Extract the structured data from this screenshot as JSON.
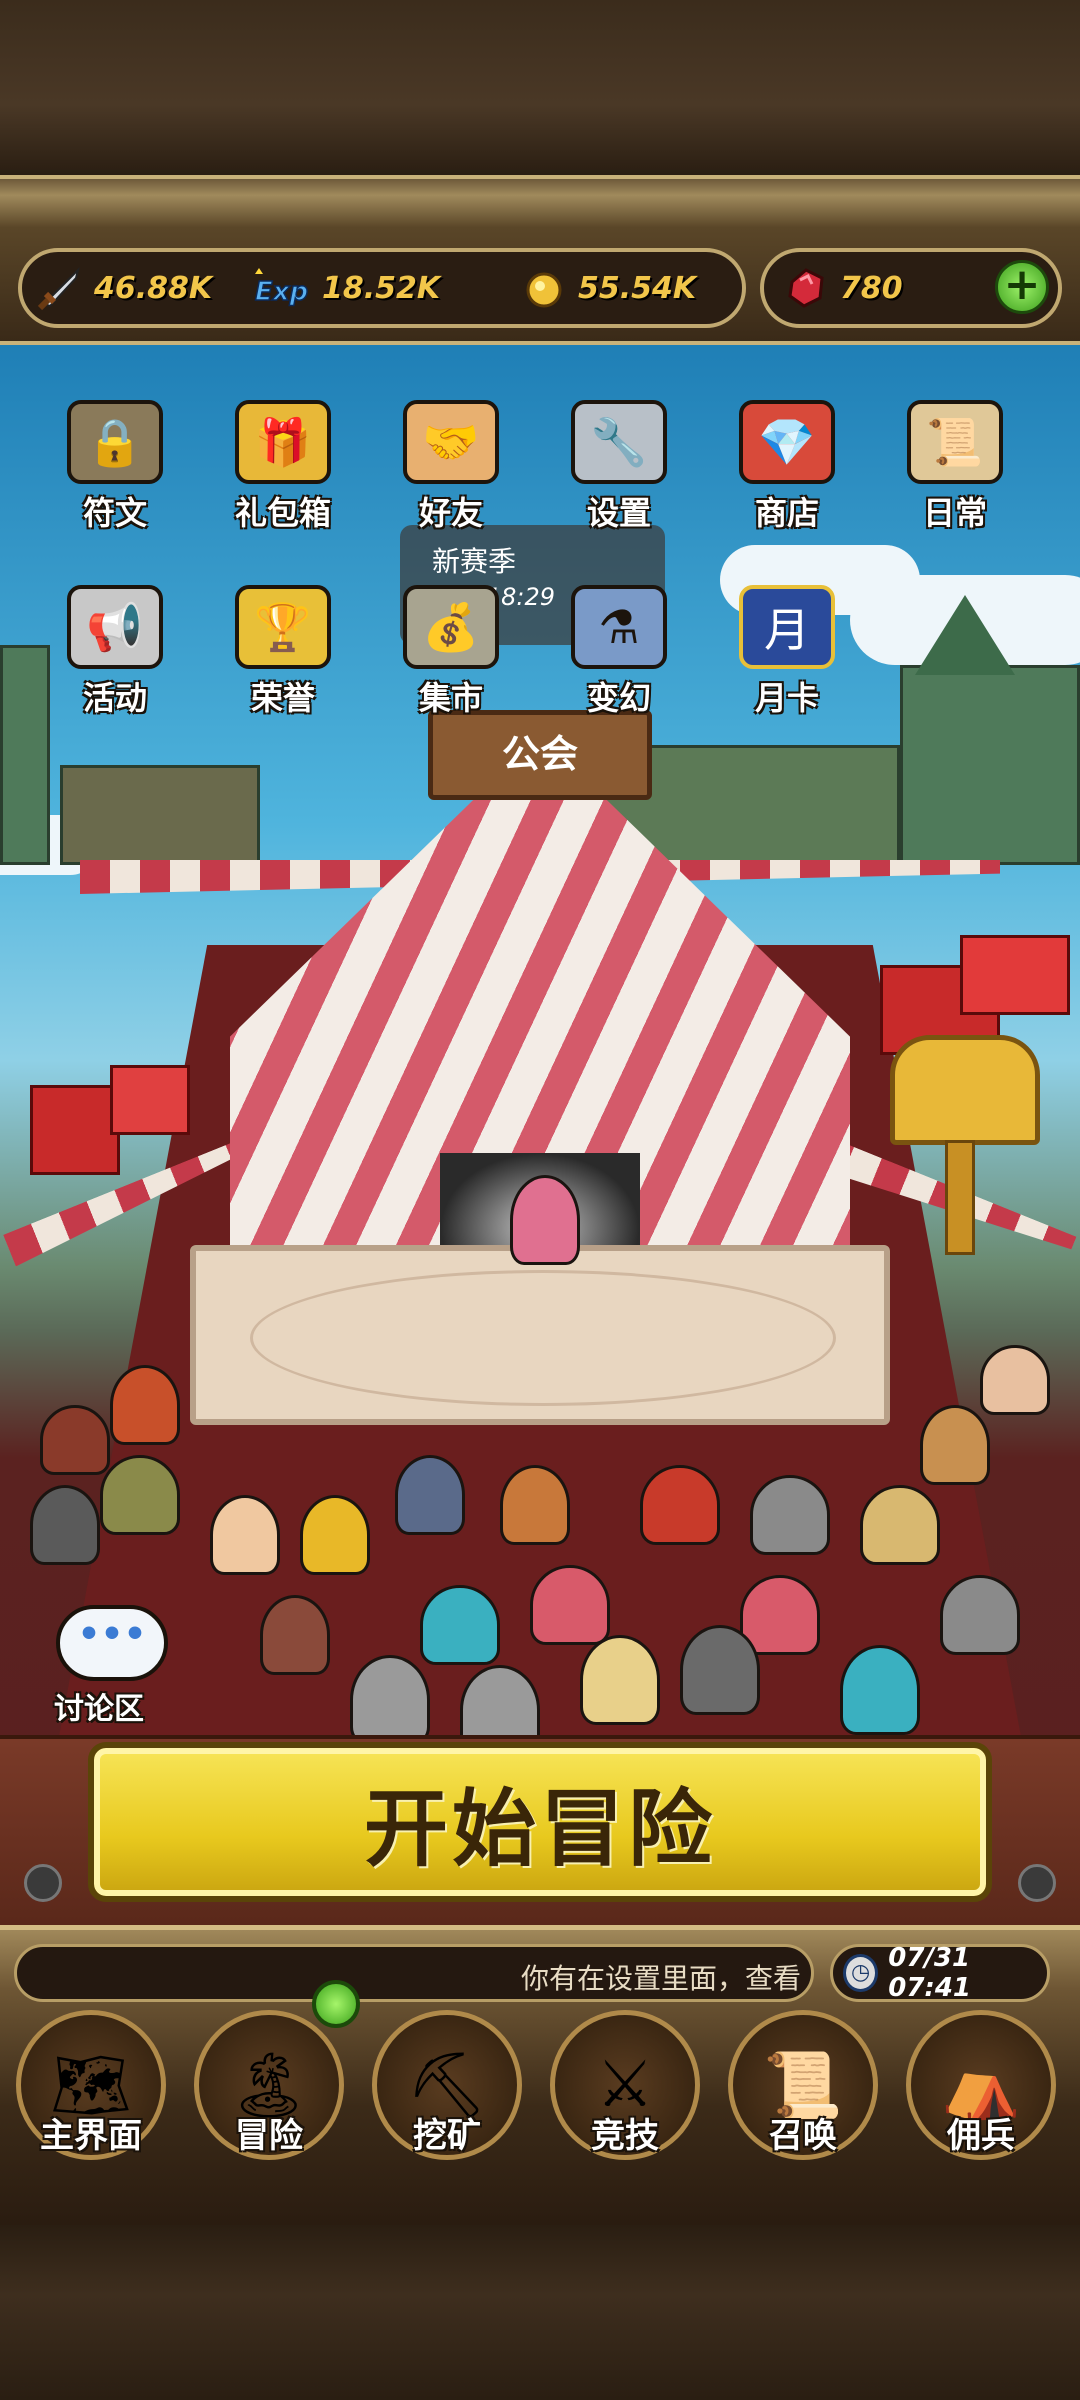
{
  "header": {
    "resources": [
      {
        "icon": "sword-icon",
        "value": "46.88K"
      },
      {
        "icon": "exp-icon",
        "value": "18.52K"
      },
      {
        "icon": "gold-coin-icon",
        "value": "55.54K"
      }
    ],
    "gems": {
      "icon": "ruby-icon",
      "value": "780"
    },
    "add_label": "+"
  },
  "menu": {
    "row1": [
      {
        "label": "符文",
        "icon": "lock-icon"
      },
      {
        "label": "礼包箱",
        "icon": "gift-box-icon"
      },
      {
        "label": "好友",
        "icon": "handshake-icon"
      },
      {
        "label": "设置",
        "icon": "wrench-icon"
      },
      {
        "label": "商店",
        "icon": "gem-shop-icon"
      },
      {
        "label": "日常",
        "icon": "scroll-quill-icon"
      }
    ],
    "row2": [
      {
        "label": "活动",
        "icon": "megaphone-icon"
      },
      {
        "label": "荣誉",
        "icon": "trophy-icon"
      },
      {
        "label": "集市",
        "icon": "money-bag-icon"
      },
      {
        "label": "变幻",
        "icon": "transform-icon"
      },
      {
        "label": "月卡",
        "icon": "month-card-icon",
        "badge": "月"
      }
    ]
  },
  "season": {
    "title": "新赛季",
    "timer": "316:18:29"
  },
  "guild_sign": "公会",
  "chat": {
    "bubble": "•••",
    "label": "讨论区"
  },
  "start_button": "开始冒险",
  "ticker": {
    "text": "你有在设置里面，查看",
    "clock": "07/31 07:41"
  },
  "nav": [
    {
      "label": "主界面",
      "icon": "map-scroll-icon"
    },
    {
      "label": "冒险",
      "icon": "island-icon"
    },
    {
      "label": "挖矿",
      "icon": "pickaxe-icon"
    },
    {
      "label": "竞技",
      "icon": "crossed-swords-icon"
    },
    {
      "label": "召唤",
      "icon": "summon-scroll-icon"
    },
    {
      "label": "佣兵",
      "icon": "tent-icon"
    }
  ],
  "colors": {
    "accent_yellow": "#f2c64a",
    "button_yellow": "#e8c91e",
    "ruby": "#d42a3a"
  }
}
